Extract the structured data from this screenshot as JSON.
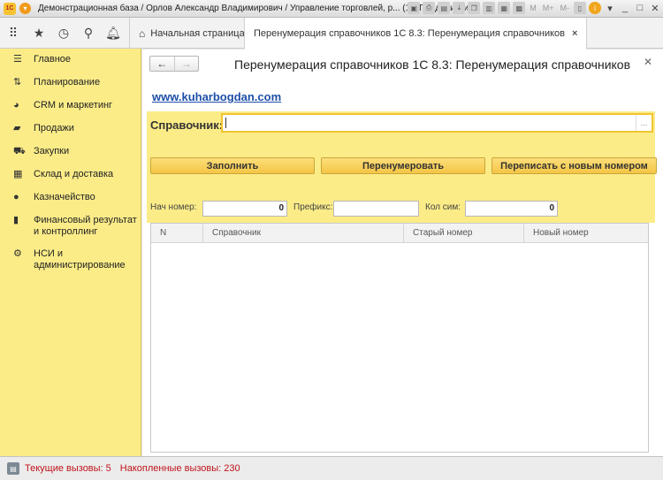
{
  "titlebar": {
    "app_badge": "1С",
    "window_title": "Демонстрационная база / Орлов Александр Владимирович / Управление торговлей, р...  (1С:Предприятие)",
    "tools": [
      "M",
      "M+",
      "M-"
    ]
  },
  "topnav": {
    "icons": [
      "apps-icon",
      "star-icon",
      "history-icon",
      "search-icon",
      "bell-icon"
    ],
    "home_tab": "Начальная страница",
    "active_tab": "Перенумерация справочников  1С 8.3: Перенумерация справочников",
    "close_glyph": "×"
  },
  "sidebar": {
    "items": [
      {
        "icon": "menu-icon",
        "label": "Главное"
      },
      {
        "icon": "planning-icon",
        "label": "Планирование"
      },
      {
        "icon": "crm-icon",
        "label": "CRM и маркетинг"
      },
      {
        "icon": "sales-icon",
        "label": "Продажи"
      },
      {
        "icon": "purchases-icon",
        "label": "Закупки"
      },
      {
        "icon": "warehouse-icon",
        "label": "Склад и доставка"
      },
      {
        "icon": "treasury-icon",
        "label": "Казначейство"
      },
      {
        "icon": "finance-icon",
        "label": "Финансовый результат и контроллинг"
      },
      {
        "icon": "admin-icon",
        "label": "НСИ и администрирование"
      }
    ]
  },
  "form": {
    "title": "Перенумерация справочников  1С 8.3: Перенумерация справочников",
    "link": "www.kuharbogdan.com",
    "catalog_label": "Справочник:",
    "catalog_value": "",
    "buttons": {
      "fill": "Заполнить",
      "renumber": "Перенумеровать",
      "rewrite": "Переписать с новым номером"
    },
    "fields": {
      "start_label": "Нач номер:",
      "start_value": "0",
      "prefix_label": "Префикс:",
      "prefix_value": "",
      "chars_label": "Кол сим:",
      "chars_value": "0"
    },
    "table": {
      "columns": [
        "N",
        "Справочник",
        "Старый номер",
        "Новый номер"
      ],
      "rows": []
    }
  },
  "statusbar": {
    "current_calls": "Текущие вызовы: 5",
    "accumulated_calls": "Накопленные вызовы: 230"
  }
}
